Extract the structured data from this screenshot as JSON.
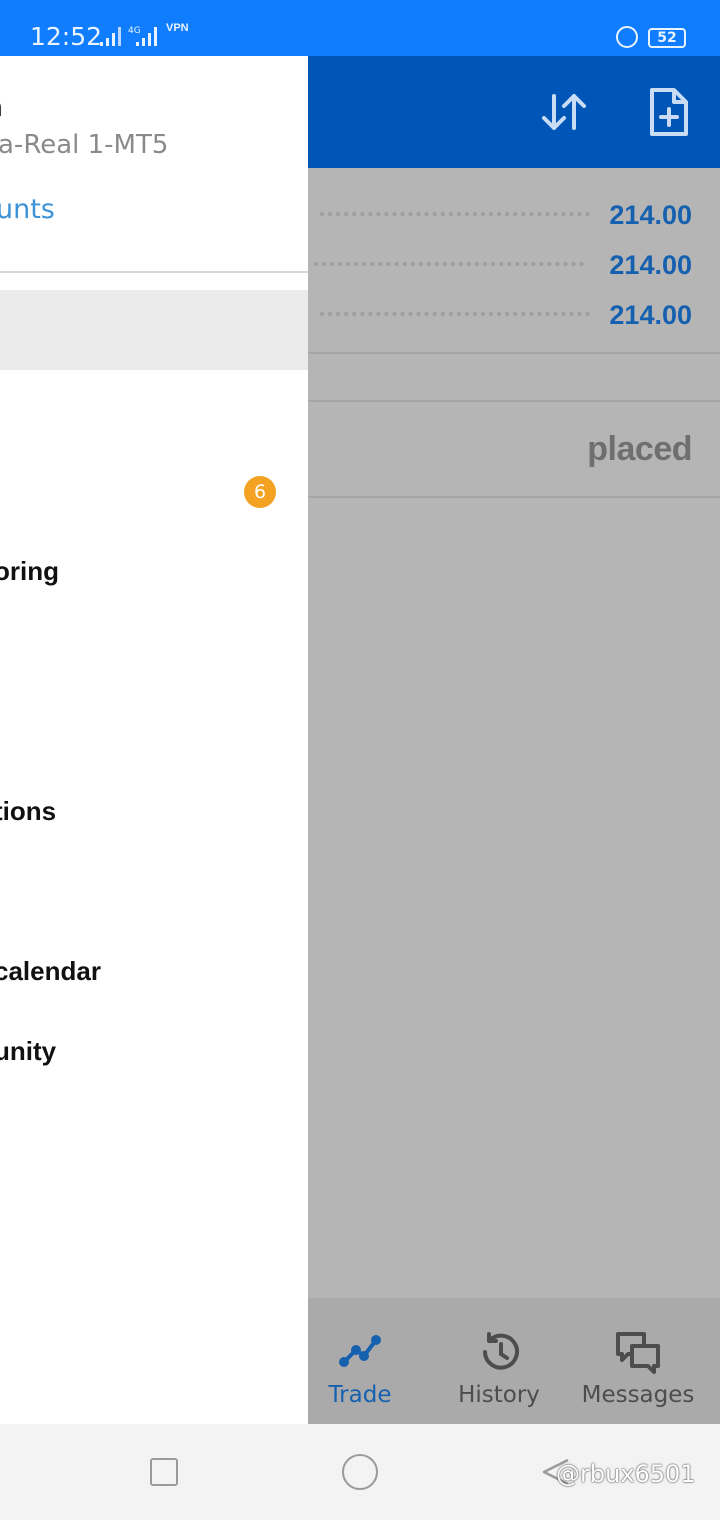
{
  "status_bar": {
    "time": "12:52",
    "network": "4G",
    "vpn": "VPN",
    "battery": "52"
  },
  "quotes": [
    "214.00",
    "214.00",
    "214.00"
  ],
  "orders_empty_text": "placed",
  "drawer": {
    "account_name": "n",
    "account_server": "a-Real 1-MT5",
    "accounts_link": "unts",
    "menu_items": [
      "oring",
      "tions",
      "calendar",
      "unity"
    ],
    "badge_count": "6"
  },
  "bottom_nav": {
    "trade": "Trade",
    "history": "History",
    "messages": "Messages"
  },
  "watermark": "@rbux6501",
  "colors": {
    "status_bar": "#0f7dfe",
    "header": "#0056b7",
    "accent": "#1660b0",
    "badge": "#f4a222",
    "link": "#3e93d6"
  },
  "icons": [
    "sort-arrows-icon",
    "new-document-icon",
    "trade-chart-icon",
    "history-clock-icon",
    "messages-chat-icon"
  ]
}
